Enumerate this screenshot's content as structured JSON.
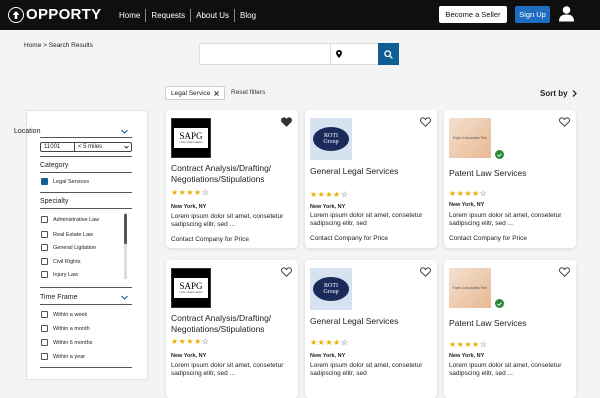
{
  "header": {
    "logo_text": "OPPORTY",
    "nav": [
      "Home",
      "Requests",
      "About Us",
      "Blog"
    ],
    "become_seller": "Become a Seller",
    "sign_up": "Sign Up"
  },
  "breadcrumb": "Home > Search Results",
  "search": {
    "placeholder": "",
    "location_placeholder": ""
  },
  "filters": {
    "active_chip": "Legal Service",
    "reset_label": "Reset filters",
    "sort_label": "Sort by"
  },
  "sidebar": {
    "location_label": "Location",
    "zip_value": "11001",
    "radius_value": "< 5 miles",
    "category_label": "Category",
    "category_option": "Legal Services",
    "specialty_label": "Specialty",
    "specialties": [
      "Administrative Law",
      "Real Estate Law",
      "General Ligitation",
      "Civil Rights",
      "Injury Law"
    ],
    "timeframe_label": "Time Frame",
    "timeframes": [
      "Within a week",
      "Within a month",
      "Within 6 months",
      "Within a year"
    ]
  },
  "cards": [
    {
      "logo": "SAPG",
      "logo_sub": "LITIGATION GROUP",
      "title": "Contract Analysis/Drafting/ Negotiations/Stipulations",
      "rating": 4,
      "location": "New York, NY",
      "desc": "Lorem ipsum dolor sit amet, consetetur sadipscing elitr, sed ...",
      "cta": "Contact Company for Price",
      "favorited": true,
      "verified": false
    },
    {
      "logo": "ROTI",
      "logo_sub": "Group",
      "title": "General Legal Services",
      "rating": 4,
      "location": "New York, NY",
      "desc": "Lorem ipsum dolor sit amet, consetetur sadipscing elitr, sed",
      "cta": "Contact Company for Price",
      "favorited": false,
      "verified": false
    },
    {
      "logo": "Knyle & Associates Firm",
      "title": "Patent Law Services",
      "rating": 4,
      "location": "New York, NY",
      "desc": "Lorem ipsum dolor sit amet, consetetur sadipscing elitr, sed ...",
      "cta": "Contact Company for Price",
      "favorited": false,
      "verified": true
    },
    {
      "logo": "SAPG",
      "logo_sub": "LITIGATION GROUP",
      "title": "Contract Analysis/Drafting/ Negotiations/Stipulations",
      "rating": 4,
      "location": "New York, NY",
      "desc": "Lorem ipsum dolor sit amet, consetetur sadipscing elitr, sed ...",
      "favorited": false,
      "verified": false
    },
    {
      "logo": "ROTI",
      "logo_sub": "Group",
      "title": "General Legal Services",
      "rating": 4,
      "location": "New York, NY",
      "desc": "Lorem ipsum dolor sit amet, consetetur sadipscing elitr, sed",
      "favorited": false,
      "verified": false
    },
    {
      "logo": "Knyle & Associates Firm",
      "title": "Patent Law Services",
      "rating": 4,
      "location": "New York, NY",
      "desc": "Lorem ipsum dolor sit amet, consetetur sadipscing elitr, sed ...",
      "favorited": false,
      "verified": true
    }
  ],
  "colors": {
    "accent": "#0f5f92",
    "signup": "#1f6dc0",
    "star": "#e8b000",
    "verified": "#2a8a3a"
  }
}
